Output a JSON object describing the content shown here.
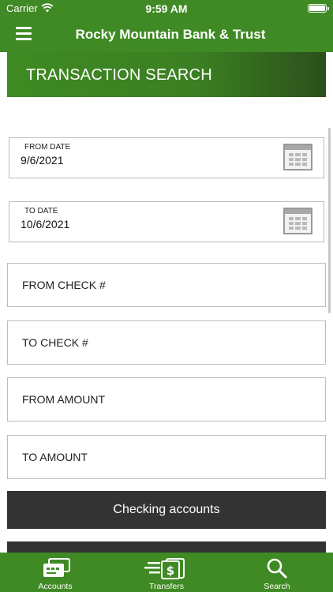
{
  "status": {
    "carrier": "Carrier",
    "time": "9:59 AM"
  },
  "nav": {
    "title": "Rocky Mountain Bank & Trust",
    "menu_icon": "hamburger-menu-icon"
  },
  "banner": {
    "title": "TRANSACTION SEARCH"
  },
  "from_date": {
    "label": "FROM DATE",
    "value": "9/6/2021"
  },
  "to_date": {
    "label": "TO DATE",
    "value": "10/6/2021"
  },
  "fields": {
    "from_check": "FROM CHECK #",
    "to_check": "TO CHECK #",
    "from_amount": "FROM AMOUNT",
    "to_amount": "TO AMOUNT"
  },
  "account_button": {
    "label": "Checking accounts"
  },
  "tabs": [
    {
      "label": "Accounts",
      "icon": "cards-icon"
    },
    {
      "label": "Transfers",
      "icon": "transfer-icon"
    },
    {
      "label": "Search",
      "icon": "search-icon"
    }
  ],
  "colors": {
    "brand_green": "#3f8a24",
    "dark_button": "#333333",
    "border": "#bcbcbc"
  }
}
